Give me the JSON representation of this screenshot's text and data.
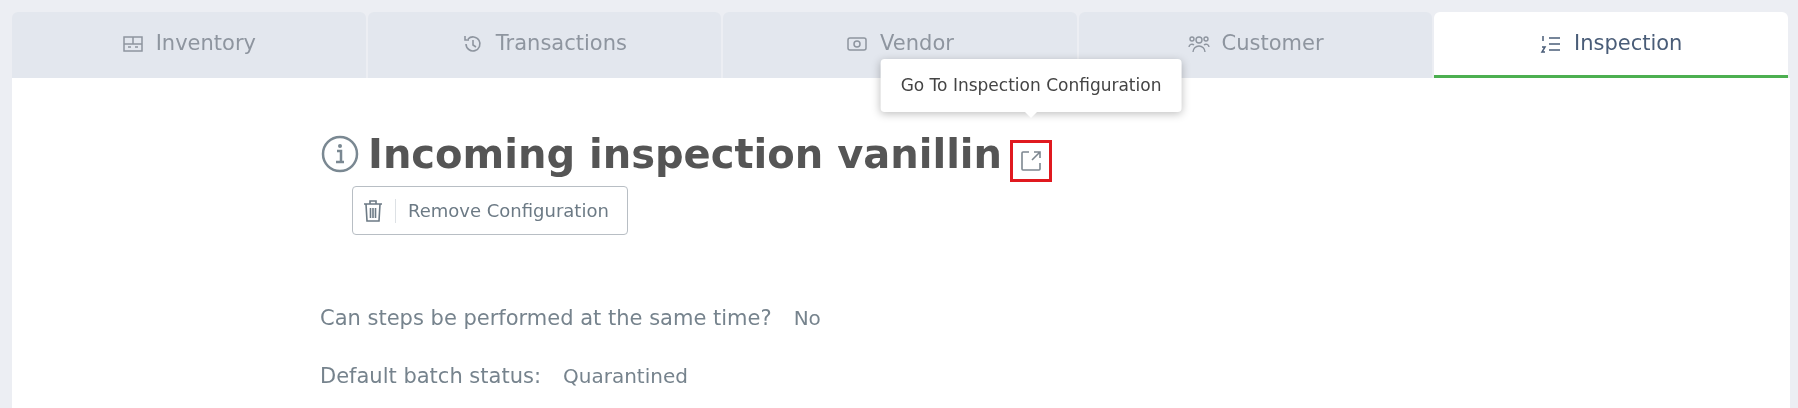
{
  "tabs": [
    {
      "label": "Inventory",
      "selected": false
    },
    {
      "label": "Transactions",
      "selected": false
    },
    {
      "label": "Vendor",
      "selected": false
    },
    {
      "label": "Customer",
      "selected": false
    },
    {
      "label": "Inspection",
      "selected": true
    }
  ],
  "title": "Incoming inspection vanillin",
  "open_link": {
    "tooltip": "Go To Inspection Configuration",
    "highlighted": true
  },
  "remove_button": "Remove Configuration",
  "fields": [
    {
      "label": "Can steps be performed at the same time?",
      "value": "No"
    },
    {
      "label": "Default batch status:",
      "value": "Quarantined"
    }
  ]
}
